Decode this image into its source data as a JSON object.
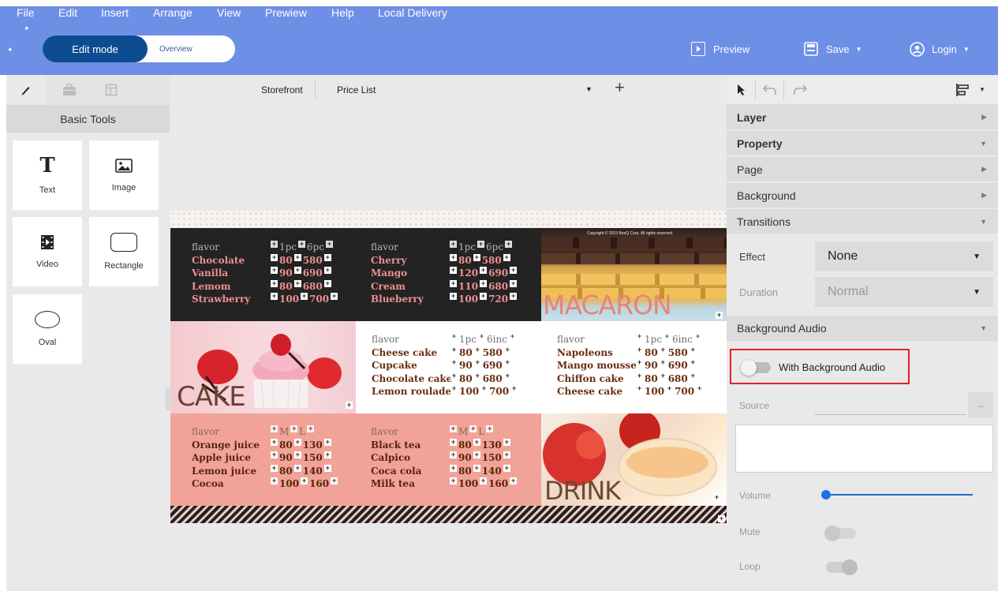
{
  "menu": [
    "File",
    "Edit",
    "Insert",
    "Arrange",
    "View",
    "Prewiew",
    "Help",
    "Local Delivery"
  ],
  "mode": {
    "edit_label": "Edit mode",
    "overview_label": "Overview"
  },
  "header_actions": {
    "preview": "Preview",
    "save": "Save",
    "login": "Login"
  },
  "left_panel": {
    "section_title": "Basic Tools",
    "tools": [
      {
        "label": "Text",
        "icon": "text-icon"
      },
      {
        "label": "Image",
        "icon": "image-icon"
      },
      {
        "label": "Video",
        "icon": "video-icon"
      },
      {
        "label": "Rectangle",
        "icon": "rectangle-icon"
      },
      {
        "label": "Oval",
        "icon": "oval-icon"
      }
    ]
  },
  "canvas_tabs": [
    "Storefront",
    "Price List"
  ],
  "menu_board": {
    "macaron_left": {
      "header": [
        "flavor",
        "1pc",
        "6pc"
      ],
      "rows": [
        [
          "Chocolate",
          "80",
          "580"
        ],
        [
          "Vanilla",
          "90",
          "690"
        ],
        [
          "Lemom",
          "80",
          "680"
        ],
        [
          "Strawberry",
          "100",
          "700"
        ]
      ]
    },
    "macaron_mid": {
      "header": [
        "flavor",
        "1pc",
        "6pc"
      ],
      "rows": [
        [
          "Cherry",
          "80",
          "580"
        ],
        [
          "Mango",
          "120",
          "690"
        ],
        [
          "Cream",
          "110",
          "680"
        ],
        [
          "Blueberry",
          "100",
          "720"
        ]
      ]
    },
    "macaron_word": "MACARON",
    "copyright": "Copyright © 2015 BeeQ Corp. All rights reserved.",
    "cake_word": "CAKE",
    "cake_mid": {
      "header": [
        "flavor",
        "1pc",
        "6inc"
      ],
      "rows": [
        [
          "Cheese cake",
          "80",
          "580"
        ],
        [
          "Cupcake",
          "90",
          "690"
        ],
        [
          "Chocolate cake",
          "80",
          "680"
        ],
        [
          "Lemon roulade",
          "100",
          "700"
        ]
      ]
    },
    "cake_right": {
      "header": [
        "flavor",
        "1pc",
        "6inc"
      ],
      "rows": [
        [
          "Napoleons",
          "80",
          "580"
        ],
        [
          "Mango mousse",
          "90",
          "690"
        ],
        [
          "Chiffon cake",
          "80",
          "680"
        ],
        [
          "Cheese cake",
          "100",
          "700"
        ]
      ]
    },
    "drink_left": {
      "header": [
        "flavor",
        "M",
        "L"
      ],
      "rows": [
        [
          "Orange juice",
          "80",
          "130"
        ],
        [
          "Apple juice",
          "90",
          "150"
        ],
        [
          "Lemon juice",
          "80",
          "140"
        ],
        [
          "Cocoa",
          "100",
          "160"
        ]
      ]
    },
    "drink_mid": {
      "header": [
        "flavor",
        "M",
        "L"
      ],
      "rows": [
        [
          "Black tea",
          "80",
          "130"
        ],
        [
          "Calpico",
          "90",
          "150"
        ],
        [
          "Coca cola",
          "80",
          "140"
        ],
        [
          "Milk tea",
          "100",
          "160"
        ]
      ]
    },
    "drink_word": "DRINK"
  },
  "right_panel": {
    "sections": [
      "Layer",
      "Property",
      "Page",
      "Background",
      "Transitions"
    ],
    "effect_label": "Effect",
    "effect_value": "None",
    "duration_label": "Duration",
    "duration_value": "Normal",
    "audio_section": "Background Audio",
    "audio_toggle_label": "With Background Audio",
    "source_label": "Source",
    "browse_label": "...",
    "volume_label": "Volume",
    "volume_level": 0,
    "mute_label": "Mute",
    "loop_label": "Loop"
  },
  "colors": {
    "header": "#6e8fe6",
    "edit_mode": "#0d4c91",
    "accent": "#1a73e8",
    "highlight": "#e0212b"
  }
}
